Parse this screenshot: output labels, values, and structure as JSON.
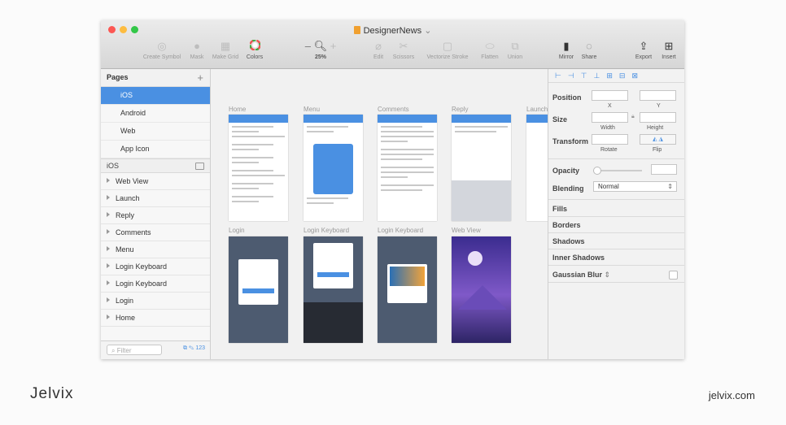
{
  "window": {
    "title": "DesignerNews",
    "title_chevron": "⌄"
  },
  "toolbar": {
    "create_symbol": "Create Symbol",
    "mask": "Mask",
    "make_grid": "Make Grid",
    "colors": "Colors",
    "zoom_minus": "–",
    "zoom_plus": "+",
    "zoom": "25%",
    "edit": "Edit",
    "scissors": "Scissors",
    "vectorize_stroke": "Vectorize Stroke",
    "flatten": "Flatten",
    "union": "Union",
    "mirror": "Mirror",
    "share": "Share",
    "export": "Export",
    "insert": "Insert"
  },
  "sidebar": {
    "pages_header": "Pages",
    "add": "+",
    "pages": [
      "iOS",
      "Android",
      "Web",
      "App Icon"
    ],
    "current_page": "iOS",
    "layers": [
      "Web View",
      "Launch",
      "Reply",
      "Comments",
      "Menu",
      "Login Keyboard",
      "Login Keyboard",
      "Login",
      "Home"
    ],
    "filter_placeholder": "Filter",
    "count": "123"
  },
  "canvas": {
    "row1": [
      "Home",
      "Menu",
      "Comments",
      "Reply",
      "Launch"
    ],
    "row2": [
      "Login",
      "Login Keyboard",
      "Login Keyboard",
      "Web View"
    ]
  },
  "inspector": {
    "position": "Position",
    "x": "X",
    "y": "Y",
    "size": "Size",
    "width": "Width",
    "height": "Height",
    "transform": "Transform",
    "rotate": "Rotate",
    "flip": "Flip",
    "opacity": "Opacity",
    "blending": "Blending",
    "blending_value": "Normal",
    "fills": "Fills",
    "borders": "Borders",
    "shadows": "Shadows",
    "inner_shadows": "Inner Shadows",
    "gaussian_blur": "Gaussian Blur"
  },
  "footer": {
    "brand": "Jelvix",
    "url": "jelvix.com"
  },
  "colors": {
    "accent": "#4a90e2",
    "close": "#fc5753",
    "minimize": "#fdbc40",
    "zoom": "#33c748"
  }
}
